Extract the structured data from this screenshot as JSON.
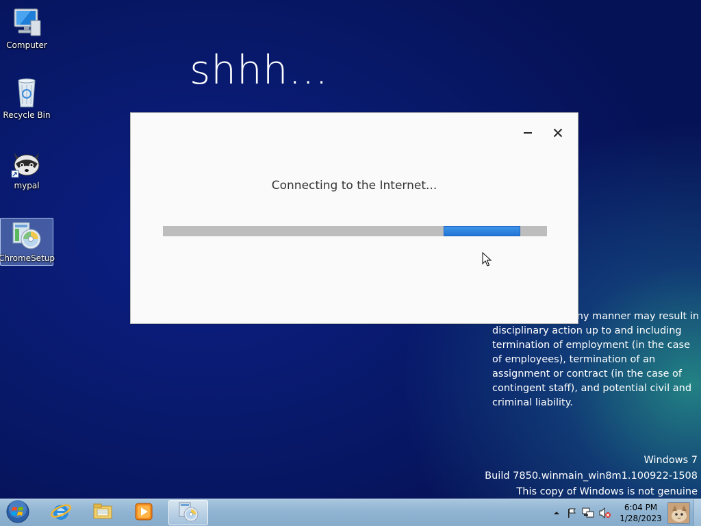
{
  "desktop": {
    "icons": [
      {
        "label": "Computer",
        "icon": "computer-icon"
      },
      {
        "label": "Recycle Bin",
        "icon": "recycle-bin-icon"
      },
      {
        "label": "mypal",
        "icon": "mypal-icon"
      },
      {
        "label": "ChromeSetup",
        "icon": "chrome-setup-icon"
      }
    ],
    "background_text_line1": "shhh...",
    "legal_text": "or disclosure in any manner may result in disciplinary action up to and including termination of employment (in the case of employees), termination of an assignment or contract (in the case of contingent staff), and potential civil and criminal liability.",
    "watermark": {
      "line1": "Windows 7",
      "line2": "Build 7850.winmain_win8m1.100922-1508",
      "line3": "This copy of Windows is not genuine"
    }
  },
  "dialog": {
    "status_text": "Connecting to the Internet...",
    "progress": {
      "start_fraction": 0.73,
      "end_fraction": 0.93
    },
    "minimize_icon": "minimize-icon",
    "close_icon": "close-icon"
  },
  "taskbar": {
    "start_icon": "windows-start-orb-icon",
    "pinned": [
      {
        "icon": "internet-explorer-icon"
      },
      {
        "icon": "file-explorer-icon"
      },
      {
        "icon": "media-player-icon"
      },
      {
        "icon": "chrome-setup-icon",
        "active": true
      }
    ],
    "tray": {
      "icons": [
        "show-hidden-icons-icon",
        "action-center-flag-icon",
        "network-icon",
        "volume-muted-icon"
      ],
      "time": "6:04 PM",
      "date": "1/28/2023"
    }
  },
  "colors": {
    "progress_fill": "#2a7ddc",
    "progress_track": "#bdbdbd",
    "taskbar": "#93b6d3"
  }
}
